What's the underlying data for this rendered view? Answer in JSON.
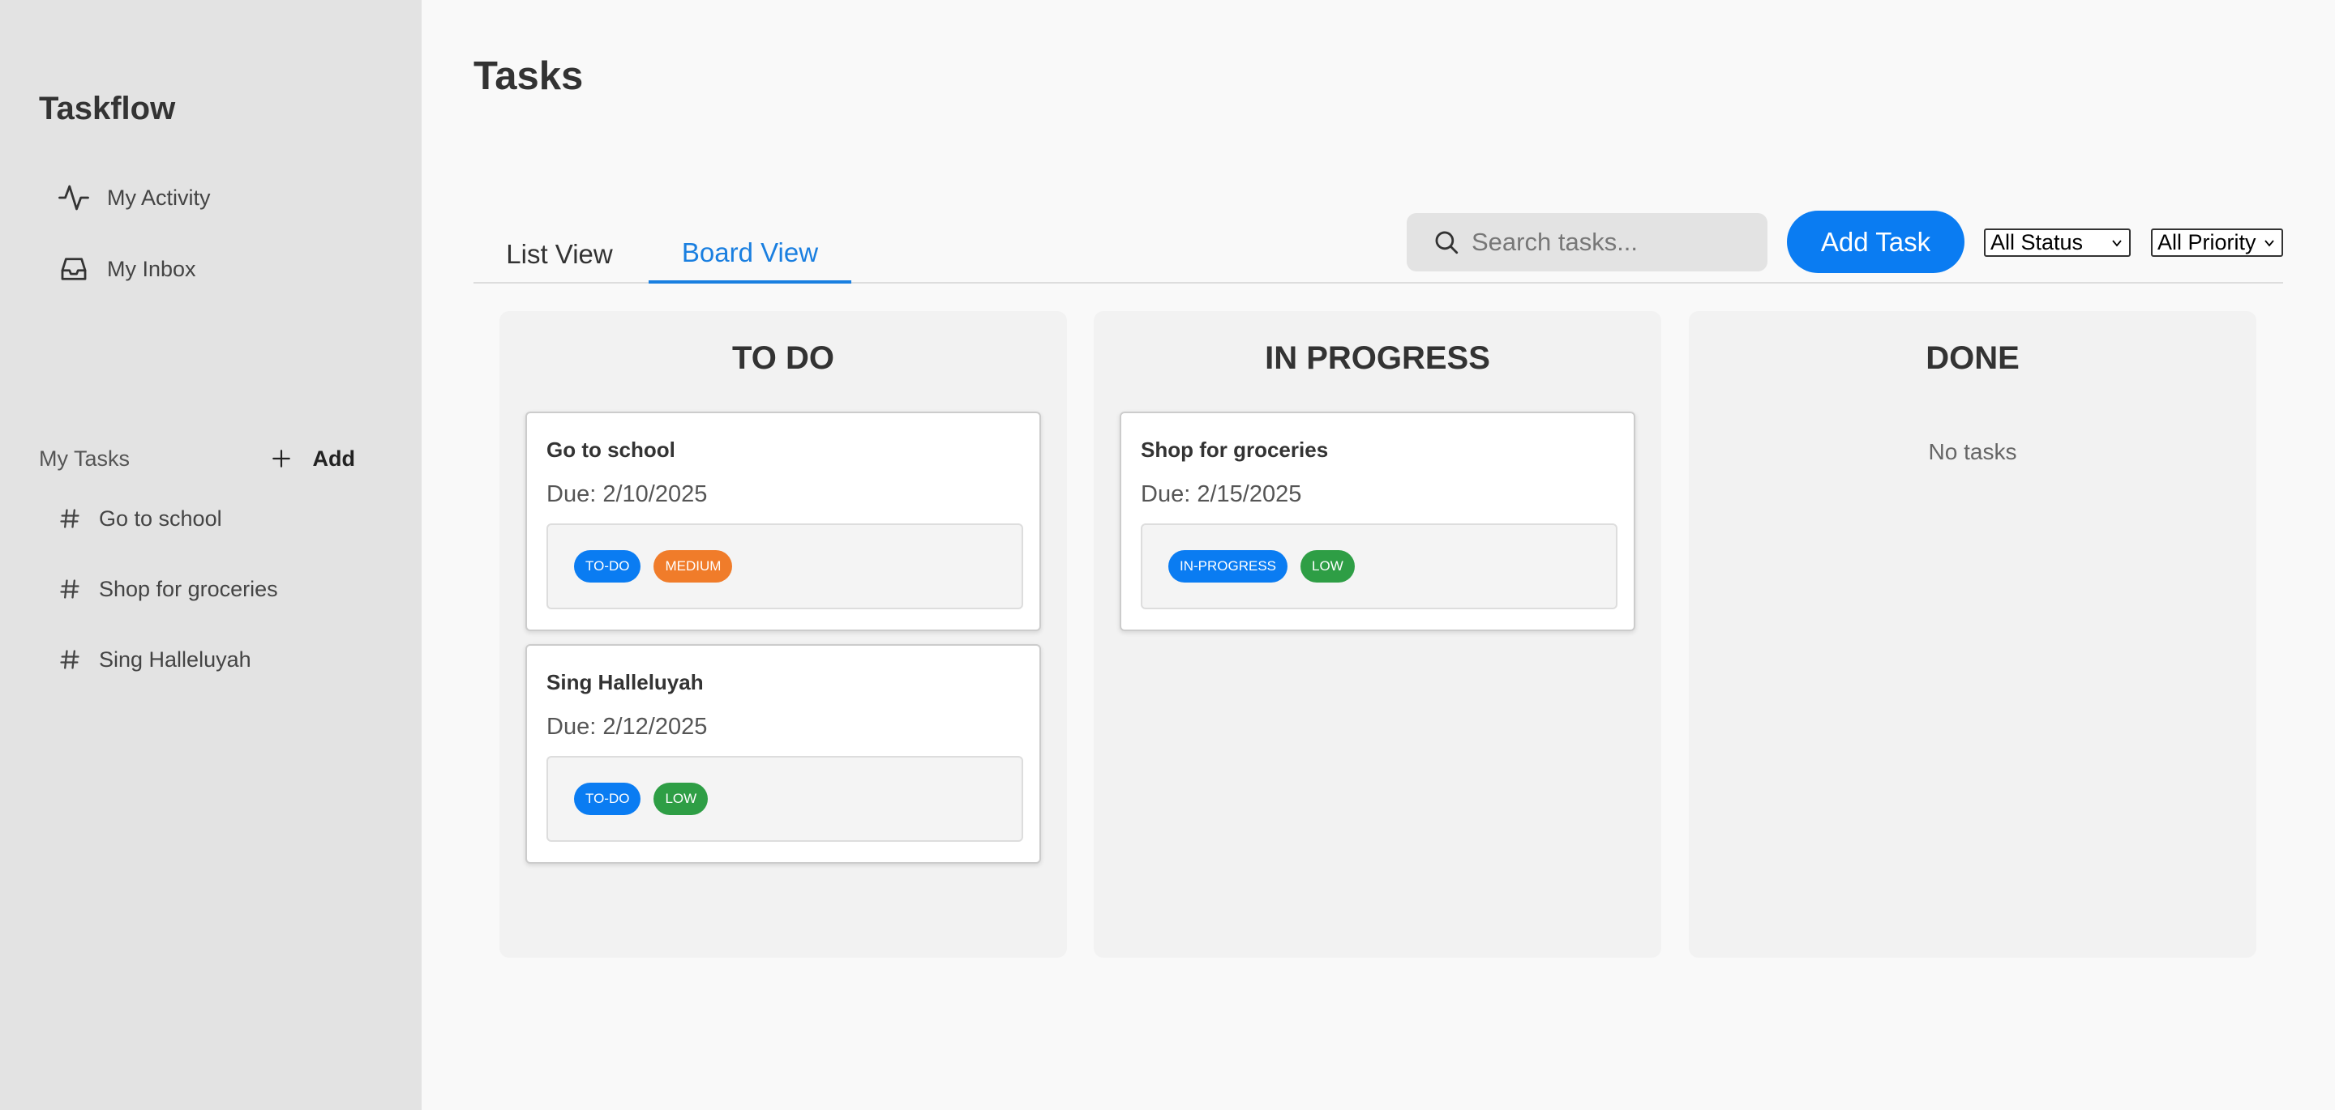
{
  "sidebar": {
    "brand": "Taskflow",
    "nav": [
      {
        "label": "My Activity",
        "icon": "activity-icon"
      },
      {
        "label": "My Inbox",
        "icon": "inbox-icon"
      }
    ],
    "my_tasks_label": "My Tasks",
    "add_label": "Add",
    "tasks": [
      {
        "label": "Go to school"
      },
      {
        "label": "Shop for groceries"
      },
      {
        "label": "Sing Halleluyah"
      }
    ]
  },
  "main": {
    "title": "Tasks",
    "tabs": [
      {
        "label": "List View",
        "active": false
      },
      {
        "label": "Board View",
        "active": true
      }
    ],
    "search": {
      "placeholder": "Search tasks...",
      "value": ""
    },
    "add_task_label": "Add Task",
    "status_filter": {
      "selected": "All Status"
    },
    "priority_filter": {
      "selected": "All Priority"
    }
  },
  "board": {
    "columns": [
      {
        "title": "TO DO",
        "empty_text": "",
        "cards": [
          {
            "title": "Go to school",
            "due": "Due: 2/10/2025",
            "status": "TO-DO",
            "priority": "MEDIUM"
          },
          {
            "title": "Sing Halleluyah",
            "due": "Due: 2/12/2025",
            "status": "TO-DO",
            "priority": "LOW"
          }
        ]
      },
      {
        "title": "IN PROGRESS",
        "empty_text": "",
        "cards": [
          {
            "title": "Shop for groceries",
            "due": "Due: 2/15/2025",
            "status": "IN-PROGRESS",
            "priority": "LOW"
          }
        ]
      },
      {
        "title": "DONE",
        "empty_text": "No tasks",
        "cards": []
      }
    ]
  },
  "colors": {
    "accent": "#0a7cf2",
    "status_badge": "#0a7cf2",
    "priority_medium": "#f07c2a",
    "priority_low": "#2e9e45",
    "sidebar_bg": "#e3e3e3",
    "page_bg": "#f9f9f9"
  }
}
